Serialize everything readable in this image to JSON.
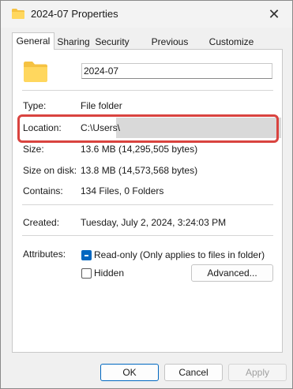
{
  "window": {
    "title": "2024-07 Properties"
  },
  "tabs": [
    {
      "label": "General",
      "active": true
    },
    {
      "label": "Sharing",
      "active": false
    },
    {
      "label": "Security",
      "active": false
    },
    {
      "label": "Previous Versions",
      "active": false
    },
    {
      "label": "Customize",
      "active": false
    }
  ],
  "general": {
    "name_value": "2024-07",
    "type": {
      "label": "Type:",
      "value": "File folder"
    },
    "location": {
      "label": "Location:",
      "value": "C:\\Users\\"
    },
    "size": {
      "label": "Size:",
      "value": "13.6 MB (14,295,505 bytes)"
    },
    "size_on_disk": {
      "label": "Size on disk:",
      "value": "13.8 MB (14,573,568 bytes)"
    },
    "contains": {
      "label": "Contains:",
      "value": "134 Files, 0 Folders"
    },
    "created": {
      "label": "Created:",
      "value": "Tuesday, July 2, 2024, 3:24:03 PM"
    },
    "attributes": {
      "label": "Attributes:",
      "readonly_label": "Read-only (Only applies to files in folder)",
      "hidden_label": "Hidden",
      "advanced_label": "Advanced..."
    }
  },
  "buttons": {
    "ok": "OK",
    "cancel": "Cancel",
    "apply": "Apply"
  },
  "colors": {
    "highlight_border": "#d9433f",
    "accent": "#0067c0",
    "folder": "#f5c242"
  },
  "icons": {
    "title": "folder-icon",
    "close": "close-icon",
    "large": "folder-icon"
  }
}
